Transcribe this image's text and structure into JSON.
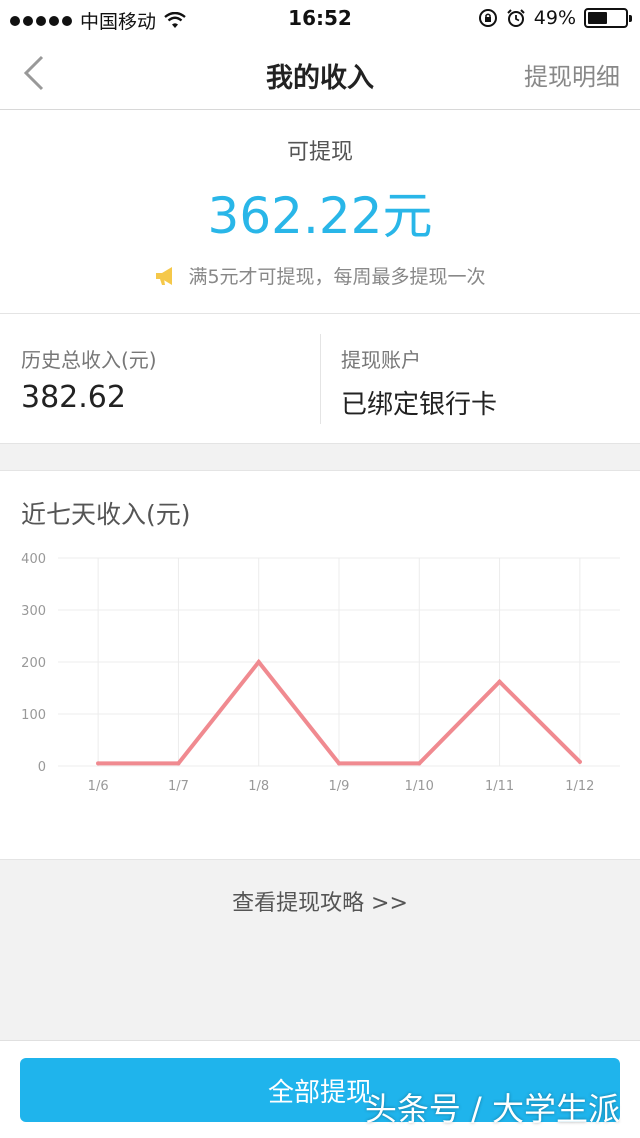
{
  "status_bar": {
    "carrier": "中国移动",
    "time": "16:52",
    "battery": "49%",
    "battery_level": 0.49
  },
  "nav": {
    "title": "我的收入",
    "right_label": "提现明细"
  },
  "balance": {
    "label": "可提现",
    "amount": "362.22元",
    "notice": "满5元才可提现，每周最多提现一次"
  },
  "summary": {
    "total_label": "历史总收入(元)",
    "total_value": "382.62",
    "account_label": "提现账户",
    "account_value": "已绑定银行卡"
  },
  "chart_section": {
    "title": "近七天收入(元)"
  },
  "chart_data": {
    "type": "line",
    "categories": [
      "1/6",
      "1/7",
      "1/8",
      "1/9",
      "1/10",
      "1/11",
      "1/12"
    ],
    "values": [
      5,
      5,
      200,
      5,
      5,
      162,
      8
    ],
    "ylim": [
      0,
      400
    ],
    "yticks": [
      "0",
      "100",
      "200",
      "300",
      "400"
    ],
    "grid": true,
    "line_color": "#f08a90"
  },
  "guide_link": "查看提现攻略 >>",
  "withdraw_button": "全部提现",
  "watermark": "头条号 / 大学生派",
  "colors": {
    "accent": "#29b6e8",
    "button": "#1fb4ec",
    "horn": "#f5c84a"
  }
}
